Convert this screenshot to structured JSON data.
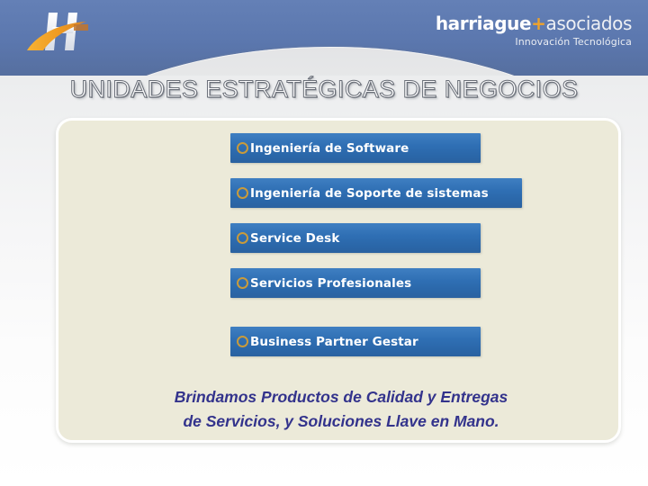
{
  "header": {
    "logo_mark_name": "harriague-h-logo",
    "brand": {
      "name_strong": "harriague",
      "name_plus": "+",
      "name_light": "asociados",
      "tagline": "Innovación Tecnológica"
    },
    "colors": {
      "band_blue": "#5b77ae",
      "accent_orange": "#f0a32a"
    }
  },
  "title": "UNIDADES ESTRATÉGICAS DE NEGOCIOS",
  "panel": {
    "background": "#ecead9",
    "border": "#ffffff",
    "bullets": [
      {
        "label": "Ingeniería de Software",
        "bullet_icon": "ring-bullet-icon",
        "width": "narrow"
      },
      {
        "label": "Ingeniería de Soporte de sistemas",
        "bullet_icon": "ring-bullet-icon",
        "width": "wide"
      },
      {
        "label": "Service Desk",
        "bullet_icon": "ring-bullet-icon",
        "width": "narrow"
      },
      {
        "label": "Servicios Profesionales",
        "bullet_icon": "ring-bullet-icon",
        "width": "narrow"
      },
      {
        "label": "Business Partner Gestar",
        "bullet_icon": "ring-bullet-icon",
        "width": "narrow"
      }
    ],
    "bullet_button_color": "#2f6fb4",
    "bullet_ring_color": "#c99b3b",
    "tagline": "Brindamos  Productos de Calidad y Entregas\nde Servicios, y Soluciones Llave en Mano.",
    "tagline_color": "#33338c"
  }
}
